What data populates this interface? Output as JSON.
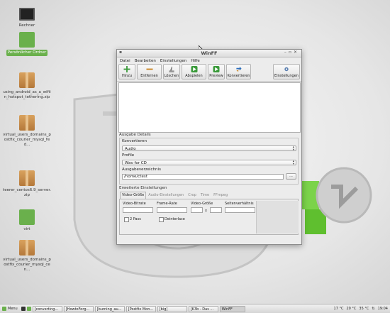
{
  "desktop": {
    "icons": [
      {
        "label": "Rechner",
        "icon": "computer-icon"
      },
      {
        "label": "Persönlicher Ordner",
        "icon": "home-folder-icon"
      },
      {
        "label": "using_android_as_a_wifiin_hotspot_tethering.zip",
        "icon": "archive-icon"
      },
      {
        "label": "virtual_users_domains_postfix_courier_mysql_fed...",
        "icon": "archive-icon"
      },
      {
        "label": "teerer_centos6.9_server.zip",
        "icon": "archive-icon"
      },
      {
        "label": "virt",
        "icon": "folder-icon"
      },
      {
        "label": "virtual_users_domains_postfix_courier_mysql_cen...",
        "icon": "archive-icon"
      }
    ]
  },
  "window": {
    "title": "WinFF",
    "menu": [
      "Datei",
      "Bearbeiten",
      "Einstellungen",
      "Hilfe"
    ],
    "toolbar": {
      "add": "Hinzu",
      "remove": "Entfernen",
      "clear": "Löschen",
      "play": "Abspielen",
      "preview": "Preview",
      "convert": "Konvertieren",
      "settings": "Einstellungen"
    },
    "output_details": {
      "section": "Ausgabe Details",
      "convert_label": "Konvertieren",
      "convert_value": "Audio",
      "profile_label": "Profile",
      "profile_value": "Wav for CD",
      "dir_label": "Ausgabeverzeichnis",
      "dir_value": "/home/ctest",
      "browse": "..."
    },
    "advanced": {
      "section": "Erweiterte Einstellungen",
      "tabs": [
        "Video-Größe",
        "Audio-Einstellungen",
        "Crop",
        "Time",
        "FFmpeg"
      ],
      "video_bitrate": "Video-Bitrate",
      "frame_rate": "Frame-Rate",
      "video_size": "Video-Größe",
      "size_sep": "x",
      "aspect": "Seitenverhältnis",
      "two_pass": "2 Pass",
      "deinterlace": "Deinterlace"
    }
  },
  "taskbar": {
    "menu": "Menu",
    "items": [
      "[converting...",
      "[HowtoForg...",
      "[burning_au...",
      "[Postfix Mon...",
      "[big]",
      "[K3b - Das ...",
      "WinFF"
    ],
    "tray": {
      "temp1": "17 °C",
      "temp2": "20 °C",
      "temp3": "35 °C",
      "time": "19:04"
    }
  },
  "colors": {
    "accent": "#6ab04c",
    "window_bg": "#ececec"
  }
}
